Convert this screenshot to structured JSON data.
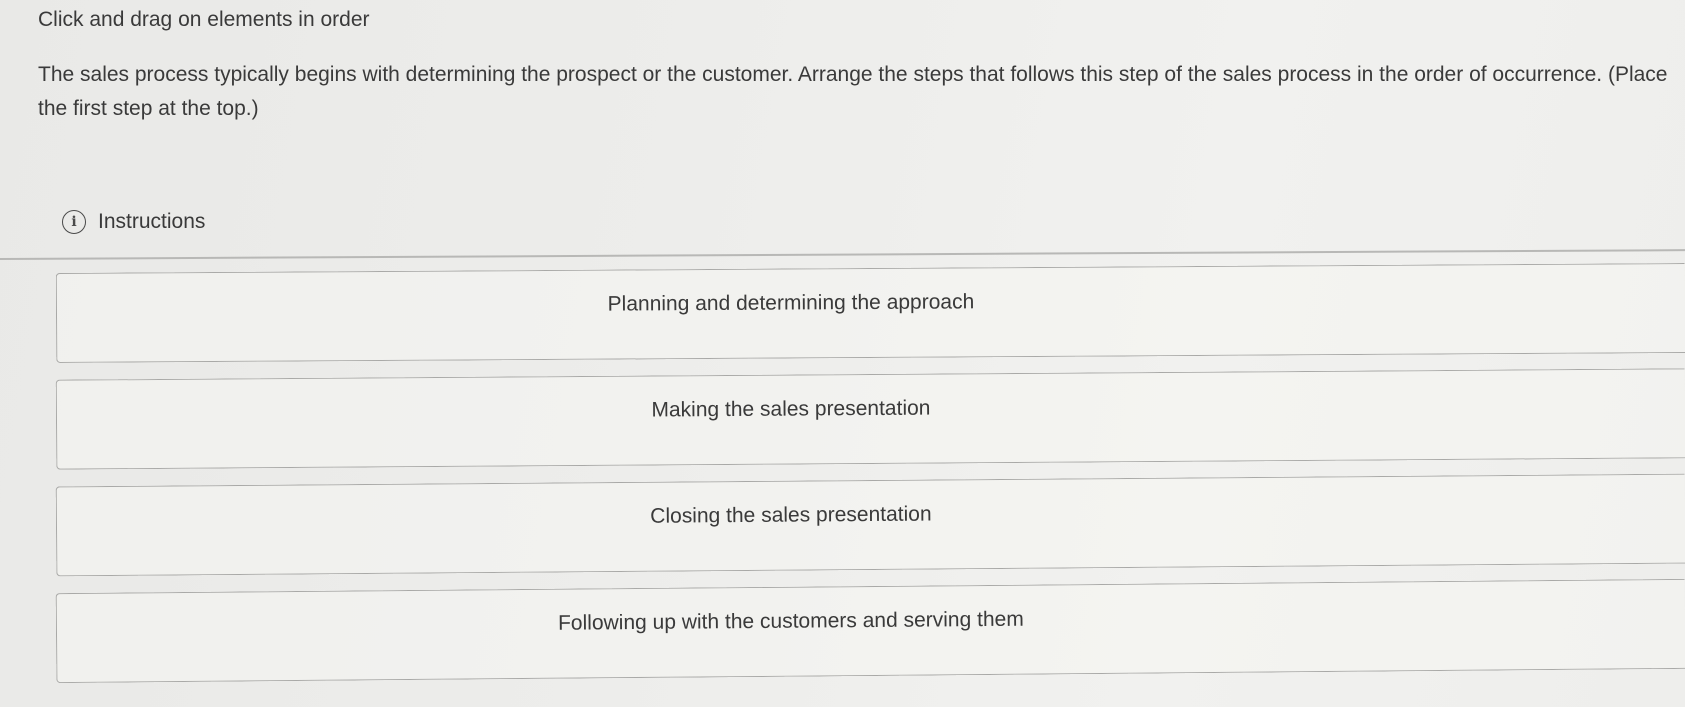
{
  "header": {
    "prompt": "Click and drag on elements in order"
  },
  "question": {
    "text": "The sales process typically begins with determining the prospect or the customer. Arrange the steps that follows this step of the sales process in the order of occurrence. (Place the first step at the top.)"
  },
  "instructions": {
    "icon": "info-icon",
    "label": "Instructions"
  },
  "steps": [
    {
      "label": "Planning and determining the approach"
    },
    {
      "label": "Making the sales presentation"
    },
    {
      "label": "Closing the sales presentation"
    },
    {
      "label": "Following up with the customers and serving them"
    }
  ]
}
